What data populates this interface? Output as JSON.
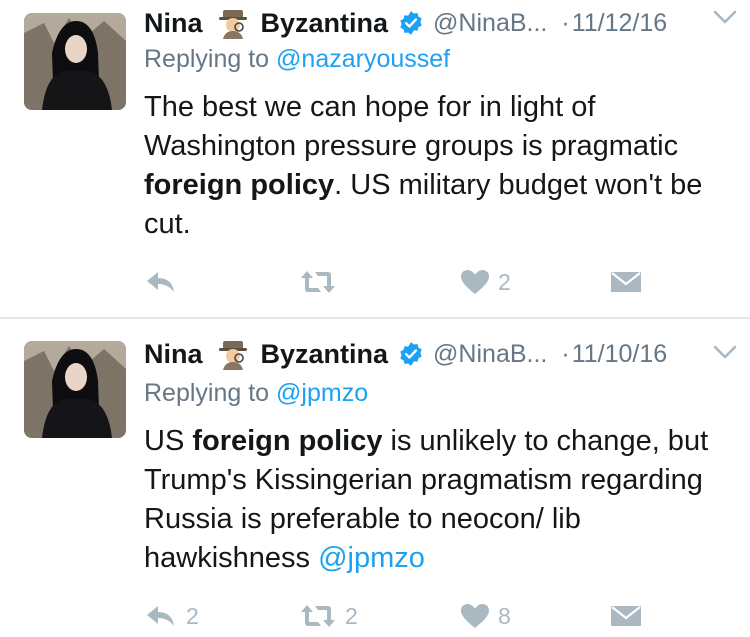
{
  "tweets": [
    {
      "name_first": "Nina",
      "name_last": "Byzantina",
      "name_emoji": "detective-emoji",
      "handle": "@NinaB...",
      "dot": "·",
      "date": "11/12/16",
      "replying_prefix": "Replying to ",
      "replying_to": "@nazaryoussef",
      "text_parts": [
        {
          "text": "The best we can hope for in light of Washington pressure groups is pragmatic ",
          "style": "normal"
        },
        {
          "text": "foreign policy",
          "style": "bold"
        },
        {
          "text": ". US military budget won't be cut.",
          "style": "normal"
        }
      ],
      "replies": "",
      "retweets": "",
      "likes": "2"
    },
    {
      "name_first": "Nina",
      "name_last": "Byzantina",
      "name_emoji": "detective-emoji",
      "handle": "@NinaB...",
      "dot": "·",
      "date": "11/10/16",
      "replying_prefix": "Replying to ",
      "replying_to": "@jpmzo",
      "text_parts": [
        {
          "text": "US ",
          "style": "normal"
        },
        {
          "text": "foreign policy",
          "style": "bold"
        },
        {
          "text": " is unlikely to change, but Trump's Kissingerian pragmatism regarding Russia is preferable to neocon/ lib hawkishness ",
          "style": "normal"
        },
        {
          "text": "@jpmzo",
          "style": "link"
        }
      ],
      "replies": "2",
      "retweets": "2",
      "likes": "8"
    }
  ],
  "colors": {
    "text": "#14171a",
    "secondary": "#657786",
    "link": "#1da1f2",
    "icon": "#aab8c2",
    "verified": "#1da1f2",
    "divider": "#e1e8ed"
  },
  "icons": [
    "reply-icon",
    "retweet-icon",
    "heart-icon",
    "direct-message-icon",
    "verified-badge-icon",
    "chevron-down-icon"
  ]
}
